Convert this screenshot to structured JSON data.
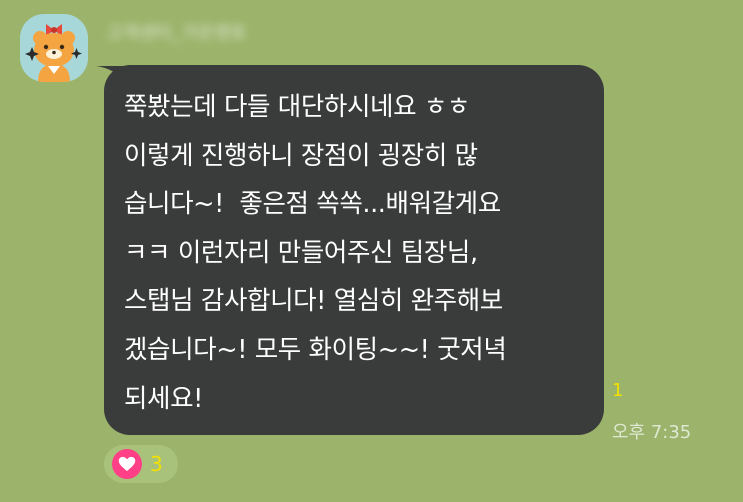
{
  "sender": {
    "name": "고객센터_가은멘토"
  },
  "message": {
    "lines": [
      "쭉봤는데 다들 대단하시네요 ㅎㅎ",
      "이렇게 진행하니 장점이 굉장히 많",
      "습니다~!  좋은점 쏙쏙...배워갈게요",
      "ㅋㅋ 이런자리 만들어주신 팀장님,",
      "스탭님 감사합니다! 열심히 완주해보",
      "겠습니다~! 모두 화이팅~~! 굿저녁",
      "되세요!"
    ]
  },
  "meta": {
    "unread_count": "1",
    "time": "오후 7:35"
  },
  "reaction": {
    "icon": "heart-icon",
    "count": "3"
  },
  "colors": {
    "background": "#9bb36a",
    "bubble": "#3a3b3b",
    "message_text": "#ffffff",
    "unread": "#f3e000",
    "heart": "#ff3f86"
  }
}
